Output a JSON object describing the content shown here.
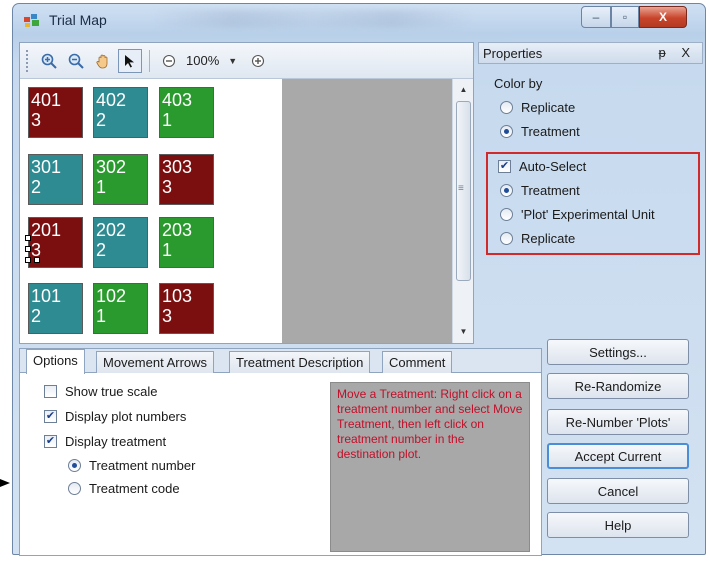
{
  "window": {
    "title": "Trial Map"
  },
  "caption_buttons": {
    "minimize": "–",
    "maximize": "▫",
    "close": "X"
  },
  "toolbar": {
    "zoom_in_icon": "zoom-in-icon",
    "zoom_out_icon": "zoom-out-icon",
    "pan_icon": "hand-icon",
    "pointer_icon": "pointer-icon",
    "zoom_level": "100%"
  },
  "colors": {
    "red": "#7b0f10",
    "teal": "#2e8b91",
    "green": "#2a9a2e",
    "hint_text": "#c0102a",
    "highlight_border": "#d12a2a"
  },
  "plots": [
    {
      "number": "401",
      "treatment": "3",
      "color": "red"
    },
    {
      "number": "402",
      "treatment": "2",
      "color": "teal"
    },
    {
      "number": "403",
      "treatment": "1",
      "color": "green"
    },
    {
      "number": "301",
      "treatment": "2",
      "color": "teal"
    },
    {
      "number": "302",
      "treatment": "1",
      "color": "green"
    },
    {
      "number": "303",
      "treatment": "3",
      "color": "red"
    },
    {
      "number": "201",
      "treatment": "3",
      "color": "red"
    },
    {
      "number": "202",
      "treatment": "2",
      "color": "teal"
    },
    {
      "number": "203",
      "treatment": "1",
      "color": "green"
    },
    {
      "number": "101",
      "treatment": "2",
      "color": "teal"
    },
    {
      "number": "102",
      "treatment": "1",
      "color": "green"
    },
    {
      "number": "103",
      "treatment": "3",
      "color": "red"
    }
  ],
  "tabs": [
    {
      "label": "Options",
      "active": true
    },
    {
      "label": "Movement Arrows",
      "active": false
    },
    {
      "label": "Treatment Description",
      "active": false
    },
    {
      "label": "Comment",
      "active": false
    }
  ],
  "options": {
    "show_true_scale": {
      "label": "Show true scale",
      "checked": false
    },
    "display_plot_numbers": {
      "label": "Display plot numbers",
      "checked": true
    },
    "display_treatment": {
      "label": "Display treatment",
      "checked": true
    },
    "treatment_number": {
      "label": "Treatment number",
      "selected": true
    },
    "treatment_code": {
      "label": "Treatment code",
      "selected": false
    }
  },
  "hint": "Move a Treatment:  Right click on a treatment number and select Move Treatment, then left click on treatment number in the destination plot.",
  "properties": {
    "header": "Properties",
    "header_buttons": "Ԅ X",
    "color_by_label": "Color by",
    "color_by": [
      {
        "label": "Replicate",
        "selected": false
      },
      {
        "label": "Treatment",
        "selected": true
      }
    ],
    "auto_select": {
      "label": "Auto-Select",
      "checked": true
    },
    "auto_select_options": [
      {
        "label": "Treatment",
        "selected": true
      },
      {
        "label": "'Plot' Experimental Unit",
        "selected": false
      },
      {
        "label": "Replicate",
        "selected": false
      }
    ]
  },
  "buttons": {
    "settings": "Settings...",
    "re_randomize": "Re-Randomize",
    "re_number": "Re-Number 'Plots'",
    "accept_current": "Accept Current",
    "cancel": "Cancel",
    "help": "Help"
  }
}
